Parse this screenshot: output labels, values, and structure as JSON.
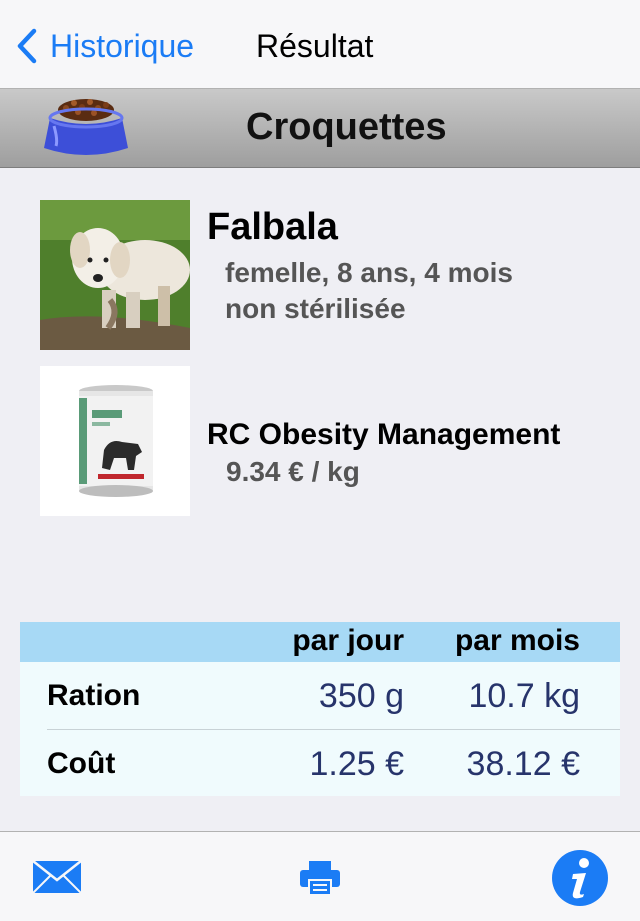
{
  "nav": {
    "back_label": "Historique",
    "title": "Résultat"
  },
  "section": {
    "title": "Croquettes",
    "icon": "food-bowl-icon"
  },
  "dog": {
    "name": "Falbala",
    "details_line1": "femelle, 8 ans, 4 mois",
    "details_line2": "non stérilisée"
  },
  "product": {
    "name": "RC Obesity Management",
    "price": "9.34 € / kg"
  },
  "table": {
    "columns": [
      "par jour",
      "par mois"
    ],
    "rows": [
      {
        "label": "Ration",
        "per_day": "350 g",
        "per_month": "10.7 kg"
      },
      {
        "label": "Coût",
        "per_day": "1.25 €",
        "per_month": "38.12 €"
      }
    ]
  },
  "toolbar": {
    "icons": [
      "mail-icon",
      "print-icon",
      "info-icon"
    ]
  },
  "colors": {
    "accent": "#1b7cf5",
    "table_header": "#a7d9f5",
    "value_text": "#27346b"
  }
}
